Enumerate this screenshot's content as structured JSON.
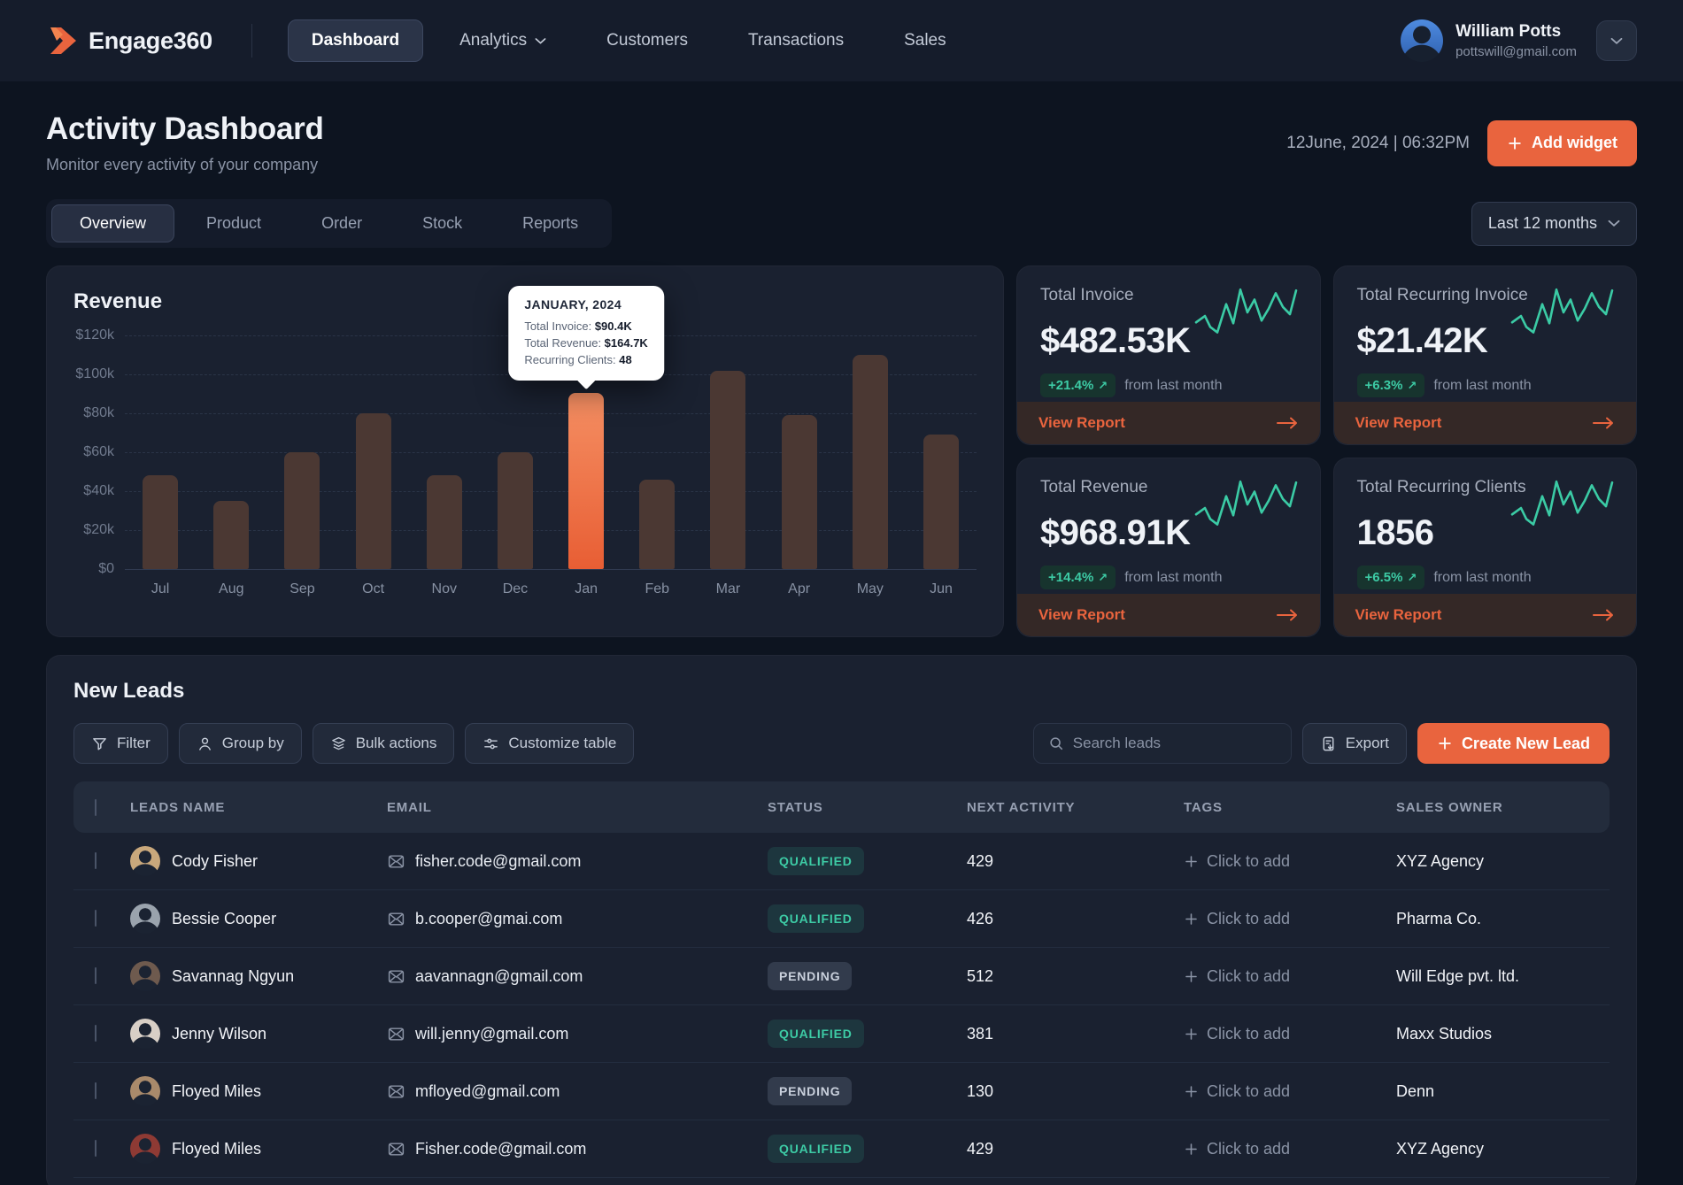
{
  "brand": {
    "name": "Engage360"
  },
  "navbar": {
    "items": [
      {
        "label": "Dashboard",
        "active": true,
        "dropdown": false
      },
      {
        "label": "Analytics",
        "active": false,
        "dropdown": true
      },
      {
        "label": "Customers",
        "active": false,
        "dropdown": false
      },
      {
        "label": "Transactions",
        "active": false,
        "dropdown": false
      },
      {
        "label": "Sales",
        "active": false,
        "dropdown": false
      }
    ],
    "user": {
      "name": "William Potts",
      "email": "pottswill@gmail.com"
    }
  },
  "header": {
    "title": "Activity Dashboard",
    "subtitle": "Monitor every activity of your company",
    "datetime": "12June, 2024 | 06:32PM",
    "add_widget": "Add widget"
  },
  "tabs": {
    "items": [
      "Overview",
      "Product",
      "Order",
      "Stock",
      "Reports"
    ],
    "active": "Overview",
    "period": "Last 12 months"
  },
  "chart_data": {
    "type": "bar",
    "title": "Revenue",
    "categories": [
      "Jul",
      "Aug",
      "Sep",
      "Oct",
      "Nov",
      "Dec",
      "Jan",
      "Feb",
      "Mar",
      "Apr",
      "May",
      "Jun"
    ],
    "values": [
      48000,
      35000,
      60000,
      80000,
      48000,
      60000,
      90400,
      46000,
      102000,
      79000,
      110000,
      69000
    ],
    "highlight_index": 6,
    "ylim": [
      0,
      120000
    ],
    "yticks": [
      "$120k",
      "$100k",
      "$80k",
      "$60k",
      "$40k",
      "$20k",
      "$0"
    ],
    "grid": "horizontal-dashed",
    "bar_color": "#4B3833",
    "highlight_color": "#ED6A3F",
    "tooltip": {
      "title": "JANUARY, 2024",
      "rows": [
        {
          "label": "Total Invoice:",
          "value": "$90.4K"
        },
        {
          "label": "Total Revenue:",
          "value": "$164.7K"
        },
        {
          "label": "Recurring Clients:",
          "value": "48"
        }
      ]
    }
  },
  "stat_cards": [
    {
      "title": "Total Invoice",
      "value": "$482.53K",
      "change": "+21.4%",
      "note": "from last month",
      "cta": "View Report"
    },
    {
      "title": "Total Recurring Invoice",
      "value": "$21.42K",
      "change": "+6.3%",
      "note": "from last month",
      "cta": "View Report"
    },
    {
      "title": "Total Revenue",
      "value": "$968.91K",
      "change": "+14.4%",
      "note": "from last month",
      "cta": "View Report"
    },
    {
      "title": "Total Recurring Clients",
      "value": "1856",
      "change": "+6.5%",
      "note": "from last month",
      "cta": "View Report"
    }
  ],
  "leads": {
    "title": "New Leads",
    "toolbar": [
      {
        "label": "Filter",
        "icon": "filter"
      },
      {
        "label": "Group by",
        "icon": "user"
      },
      {
        "label": "Bulk actions",
        "icon": "layers"
      },
      {
        "label": "Customize table",
        "icon": "sliders"
      }
    ],
    "search_placeholder": "Search leads",
    "export_label": "Export",
    "create_label": "Create New Lead",
    "table": {
      "headers": [
        "LEADS NAME",
        "EMAIL",
        "STATUS",
        "NEXT ACTIVITY",
        "TAGS",
        "SALES OWNER"
      ],
      "tag_placeholder": "Click to add",
      "rows": [
        {
          "name": "Cody Fisher",
          "email": "fisher.code@gmail.com",
          "status": "QUALIFIED",
          "activity": "429",
          "owner": "XYZ Agency",
          "avatar_color": "#C9A87C"
        },
        {
          "name": "Bessie Cooper",
          "email": "b.cooper@gmai.com",
          "status": "QUALIFIED",
          "activity": "426",
          "owner": "Pharma Co.",
          "avatar_color": "#9AA3AD"
        },
        {
          "name": "Savannag Ngyun",
          "email": "aavannagn@gmail.com",
          "status": "PENDING",
          "activity": "512",
          "owner": "Will Edge pvt. ltd.",
          "avatar_color": "#6E5A4E"
        },
        {
          "name": "Jenny Wilson",
          "email": "will.jenny@gmail.com",
          "status": "QUALIFIED",
          "activity": "381",
          "owner": "Maxx Studios",
          "avatar_color": "#D8CFC6"
        },
        {
          "name": "Floyed Miles",
          "email": "mfloyed@gmail.com",
          "status": "PENDING",
          "activity": "130",
          "owner": "Denn",
          "avatar_color": "#A98A6B"
        },
        {
          "name": "Floyed Miles",
          "email": "Fisher.code@gmail.com",
          "status": "QUALIFIED",
          "activity": "429",
          "owner": "XYZ Agency",
          "avatar_color": "#8E3A34"
        }
      ]
    }
  },
  "colors": {
    "accent": "#E9643E",
    "teal": "#3BCBA5",
    "qualified_text": "#3DCBA5",
    "background": "#0D1420",
    "card": "#1A2130"
  }
}
